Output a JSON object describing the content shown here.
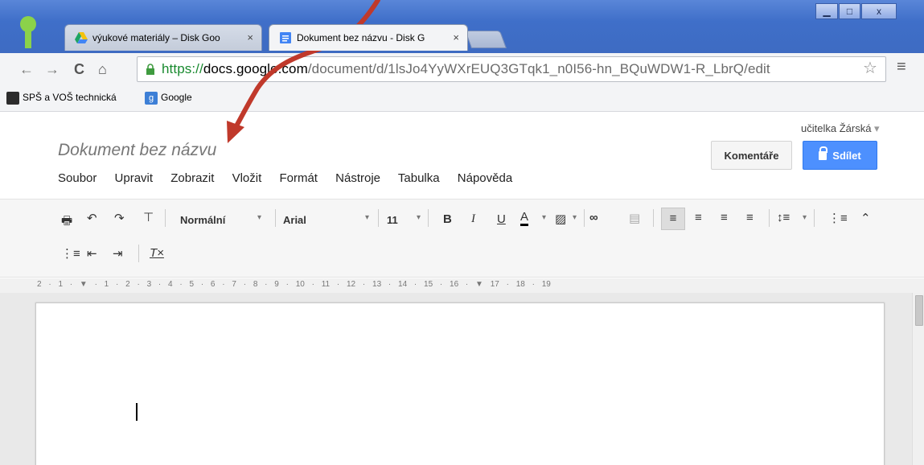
{
  "browser": {
    "tabs": [
      {
        "title": "výukové materiály – Disk Goo",
        "close": "×"
      },
      {
        "title": "Dokument bez názvu - Disk G",
        "close": "×"
      }
    ],
    "window_controls": {
      "minimize": "▁",
      "maximize": "□",
      "close": "x"
    },
    "url": {
      "scheme": "https://",
      "host": "docs.google.com",
      "path": "/document/d/1lsJo4YyWXrEUQ3GTqk1_n0I56-hn_BQuWDW1-R_LbrQ/edit"
    },
    "bookmarks": [
      {
        "label": "SPŠ a VOŠ technická",
        "icon": "school-icon"
      },
      {
        "label": "Google",
        "icon": "google-icon"
      }
    ]
  },
  "docs": {
    "user": "učitelka Žárská",
    "title": "Dokument bez názvu",
    "menu": [
      "Soubor",
      "Upravit",
      "Zobrazit",
      "Vložit",
      "Formát",
      "Nástroje",
      "Tabulka",
      "Nápověda"
    ],
    "comments_label": "Komentáře",
    "share_label": "Sdílet",
    "toolbar": {
      "style": "Normální",
      "font": "Arial",
      "size": "11"
    },
    "ruler": "2 · 1 · ▼ · 1 · 2 · 3 · 4 · 5 · 6 · 7 · 8 · 9 · 10 · 11 · 12 · 13 · 14 · 15 · 16 · ▼ 17 · 18 · 19"
  },
  "colors": {
    "share_button": "#4d90fe",
    "annotation_arrow": "#c0392b"
  }
}
